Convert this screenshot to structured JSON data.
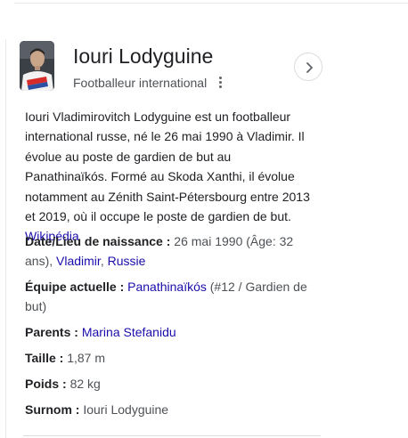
{
  "entity": {
    "name": "Iouri Lodyguine",
    "subtitle": "Footballeur international"
  },
  "description": {
    "text": "Iouri Vladimirovitch Lodyguine est un footballeur international russe, né le 26 mai 1990 à Vladimir. Il évolue au poste de gardien de but au Panathinaïkós. Formé au Skoda Xanthi, il évolue notamment au Zénith Saint-Pétersbourg entre 2013 et 2019, où il occupe le poste de gardien de but.",
    "source_link": "Wikipédia"
  },
  "facts": {
    "birth": {
      "label": "Date/Lieu de naissance :",
      "value": "26 mai 1990 (Âge: 32 ans),",
      "link1": "Vladimir",
      "sep": ",",
      "link2": "Russie"
    },
    "team": {
      "label": "Équipe actuelle :",
      "link": "Panathinaïkós",
      "value": "(#12 / Gardien de but)"
    },
    "parents": {
      "label": "Parents :",
      "link": "Marina Stefanidu"
    },
    "height": {
      "label": "Taille :",
      "value": "1,87 m"
    },
    "weight": {
      "label": "Poids :",
      "value": "82 kg"
    },
    "nickname": {
      "label": "Surnom :",
      "value": "Iouri Lodyguine"
    }
  },
  "icons": {
    "more": "more-vert-icon",
    "next": "chevron-right-icon"
  },
  "colors": {
    "link": "#1a0dab",
    "text": "#202124",
    "secondary": "#4d5156",
    "border": "#dadce0"
  }
}
